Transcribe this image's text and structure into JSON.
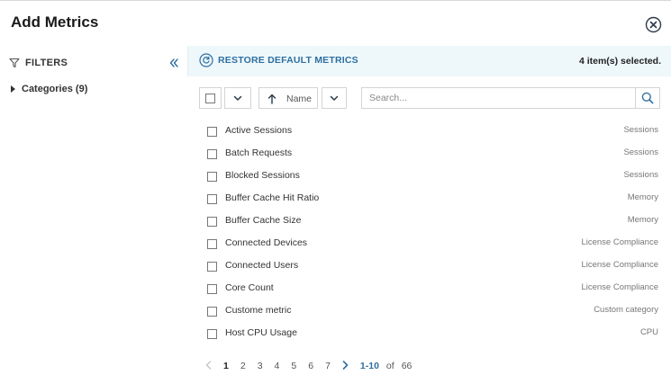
{
  "dialog": {
    "title": "Add Metrics"
  },
  "sidebar": {
    "filters_label": "FILTERS",
    "categories_label": "Categories (9)"
  },
  "header_bar": {
    "restore_label": "RESTORE DEFAULT METRICS",
    "selected_text": "4 item(s) selected."
  },
  "toolbar": {
    "sort_label": "Name",
    "search_placeholder": "Search..."
  },
  "metrics": [
    {
      "name": "Active Sessions",
      "category": "Sessions",
      "checked": false
    },
    {
      "name": "Batch Requests",
      "category": "Sessions",
      "checked": false
    },
    {
      "name": "Blocked Sessions",
      "category": "Sessions",
      "checked": false
    },
    {
      "name": "Buffer Cache Hit Ratio",
      "category": "Memory",
      "checked": false
    },
    {
      "name": "Buffer Cache Size",
      "category": "Memory",
      "checked": false
    },
    {
      "name": "Connected Devices",
      "category": "License Compliance",
      "checked": false
    },
    {
      "name": "Connected Users",
      "category": "License Compliance",
      "checked": false
    },
    {
      "name": "Core Count",
      "category": "License Compliance",
      "checked": false
    },
    {
      "name": "Custome metric",
      "category": "Custom category",
      "checked": false
    },
    {
      "name": "Host CPU Usage",
      "category": "CPU",
      "checked": false
    }
  ],
  "pagination": {
    "pages": [
      "1",
      "2",
      "3",
      "4",
      "5",
      "6",
      "7"
    ],
    "current": "1",
    "range": "1-10",
    "of_label": "of",
    "total": "66"
  },
  "colors": {
    "accent": "#2f6fa0",
    "header_bar_bg": "#eef8fb"
  },
  "icons": [
    "close-icon",
    "filter-icon",
    "collapse-icon",
    "caret-right-icon",
    "restore-icon",
    "chevron-down-icon",
    "sort-up-icon",
    "search-icon",
    "chevron-left-icon",
    "chevron-right-icon"
  ]
}
